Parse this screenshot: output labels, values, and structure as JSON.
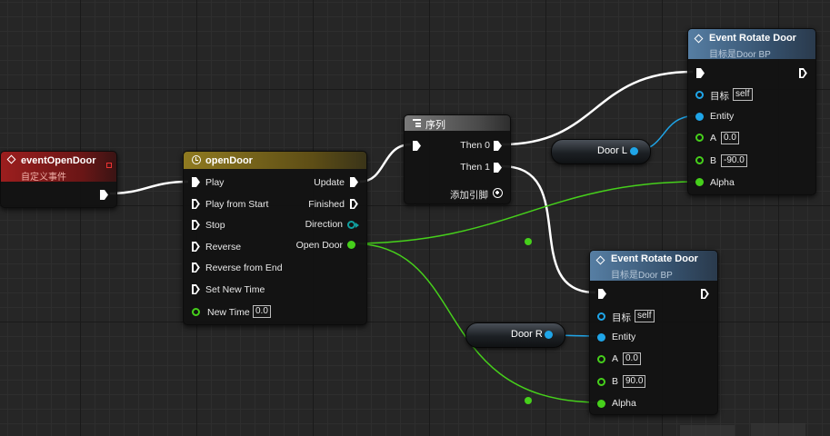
{
  "nodes": {
    "event_open_door": {
      "title": "eventOpenDoor",
      "subtitle": "自定义事件"
    },
    "open_door": {
      "title": "openDoor",
      "inputs": [
        "Play",
        "Play from Start",
        "Stop",
        "Reverse",
        "Reverse from End",
        "Set New Time",
        "New Time"
      ],
      "new_time_value": "0.0",
      "outputs": [
        "Update",
        "Finished",
        "Direction",
        "Open Door"
      ]
    },
    "sequence": {
      "title": "序列",
      "then0": "Then 0",
      "then1": "Then 1",
      "add_pin": "添加引脚"
    },
    "rotate_door_l": {
      "title": "Event Rotate Door",
      "subtitle": "目标是Door BP",
      "target_label": "目标",
      "target_value": "self",
      "entity_label": "Entity",
      "a_label": "A",
      "a_value": "0.0",
      "b_label": "B",
      "b_value": "-90.0",
      "alpha_label": "Alpha"
    },
    "rotate_door_r": {
      "title": "Event Rotate Door",
      "subtitle": "目标是Door BP",
      "target_label": "目标",
      "target_value": "self",
      "entity_label": "Entity",
      "a_label": "A",
      "a_value": "0.0",
      "b_label": "B",
      "b_value": "90.0",
      "alpha_label": "Alpha"
    }
  },
  "variables": {
    "door_l": "Door L",
    "door_r": "Door R"
  },
  "colors": {
    "exec_wire": "#ffffff",
    "float_wire": "#46d01b",
    "object_wire": "#1fa5e8",
    "event_header": "#8a1a1a",
    "timeline_header": "#7a6418",
    "function_header": "#3e5a78",
    "sequence_header": "#6a6a6a"
  }
}
